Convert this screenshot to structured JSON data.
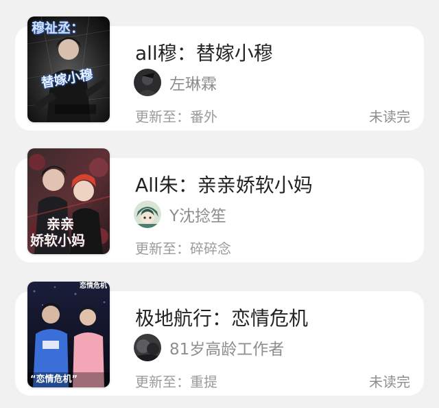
{
  "books": [
    {
      "title": "all穆：替嫁小穆",
      "author": "左琳霖",
      "update": "更新至：番外",
      "status": "未读完",
      "cover_text": [
        "穆祉丞：",
        "替嫁小穆"
      ],
      "cover_icon": "book-cover-portrait",
      "avatar_icon": "user-avatar"
    },
    {
      "title": "All朱：亲亲娇软小妈",
      "author": "Y沈捻笙",
      "update": "更新至：碎碎念",
      "status": "",
      "cover_text": [
        "亲亲",
        "娇软小妈"
      ],
      "cover_icon": "book-cover-portrait",
      "avatar_icon": "user-avatar"
    },
    {
      "title": "极地航行：恋情危机",
      "author": "81岁高龄工作者",
      "update": "更新至：重提",
      "status": "未读完",
      "cover_text": [
        "恋情危机",
        "“恋情危机”"
      ],
      "cover_icon": "book-cover-photo",
      "avatar_icon": "user-avatar"
    }
  ],
  "colors": {
    "background": "#f1f1f1",
    "card": "#ffffff",
    "title": "#222222",
    "secondary": "#8d8d8d"
  }
}
